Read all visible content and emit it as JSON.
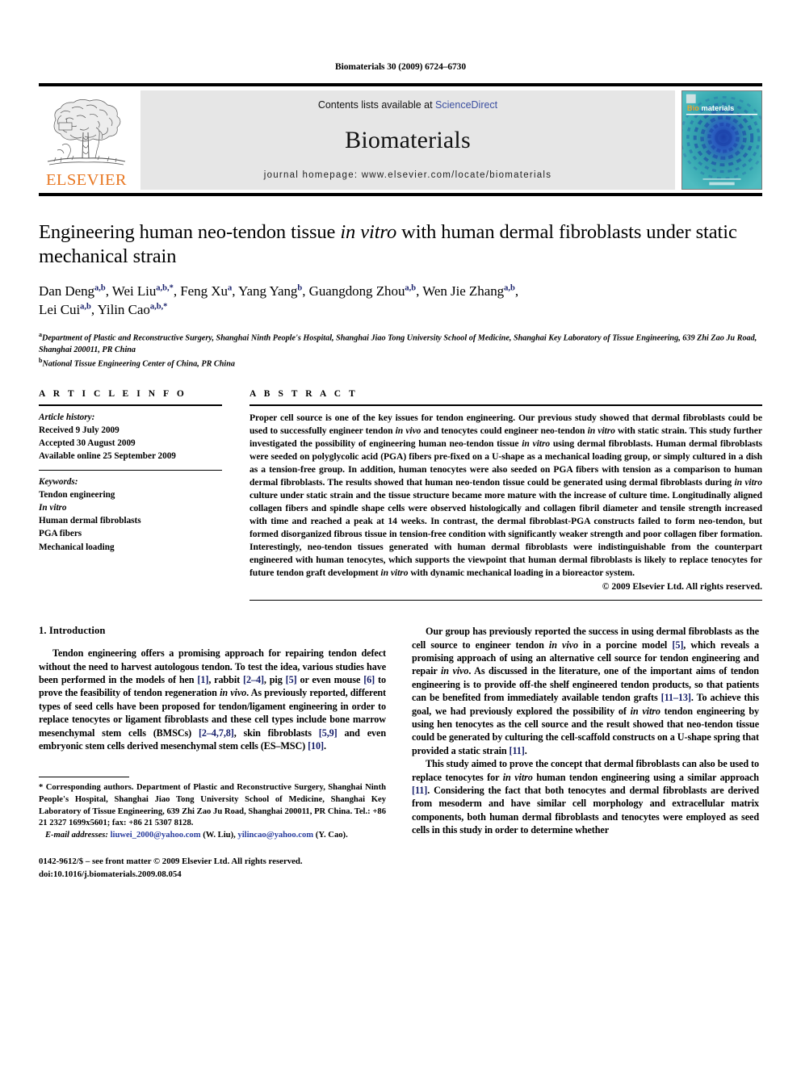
{
  "running_head": "Biomaterials 30 (2009) 6724–6730",
  "masthead": {
    "publisher_name": "ELSEVIER",
    "contents_prefix": "Contents lists available at ",
    "contents_link": "ScienceDirect",
    "journal_title": "Biomaterials",
    "homepage": "journal homepage: www.elsevier.com/locate/biomaterials",
    "cover_title_bio": "Bio",
    "cover_title_materials": "materials"
  },
  "article": {
    "title_part1": "Engineering human neo-tendon tissue ",
    "title_italic": "in vitro",
    "title_part2": " with human dermal fibroblasts under static mechanical strain",
    "authors": "Dan Deng a,b, Wei Liu a,b,*, Feng Xu a, Yang Yang b, Guangdong Zhou a,b, Wen Jie Zhang a,b, Lei Cui a,b, Yilin Cao a,b,*",
    "affiliation_a": "Department of Plastic and Reconstructive Surgery, Shanghai Ninth People's Hospital, Shanghai Jiao Tong University School of Medicine, Shanghai Key Laboratory of Tissue Engineering, 639 Zhi Zao Ju Road, Shanghai 200011, PR China",
    "affiliation_b": "National Tissue Engineering Center of China, PR China"
  },
  "article_info": {
    "heading": "A R T I C L E   I N F O",
    "history_label": "Article history:",
    "history": [
      "Received 9 July 2009",
      "Accepted 30 August 2009",
      "Available online 25 September 2009"
    ],
    "keywords_label": "Keywords:",
    "keywords": [
      "Tendon engineering",
      "In vitro",
      "Human dermal fibroblasts",
      "PGA fibers",
      "Mechanical loading"
    ]
  },
  "abstract": {
    "heading": "A B S T R A C T",
    "text": "Proper cell source is one of the key issues for tendon engineering. Our previous study showed that dermal fibroblasts could be used to successfully engineer tendon in vivo and tenocytes could engineer neo-tendon in vitro with static strain. This study further investigated the possibility of engineering human neo-tendon tissue in vitro using dermal fibroblasts. Human dermal fibroblasts were seeded on polyglycolic acid (PGA) fibers pre-fixed on a U-shape as a mechanical loading group, or simply cultured in a dish as a tension-free group. In addition, human tenocytes were also seeded on PGA fibers with tension as a comparison to human dermal fibroblasts. The results showed that human neo-tendon tissue could be generated using dermal fibroblasts during in vitro culture under static strain and the tissue structure became more mature with the increase of culture time. Longitudinally aligned collagen fibers and spindle shape cells were observed histologically and collagen fibril diameter and tensile strength increased with time and reached a peak at 14 weeks. In contrast, the dermal fibroblast-PGA constructs failed to form neo-tendon, but formed disorganized fibrous tissue in tension-free condition with significantly weaker strength and poor collagen fiber formation. Interestingly, neo-tendon tissues generated with human dermal fibroblasts were indistinguishable from the counterpart engineered with human tenocytes, which supports the viewpoint that human dermal fibroblasts is likely to replace tenocytes for future tendon graft development in vitro with dynamic mechanical loading in a bioreactor system.",
    "copyright": "© 2009 Elsevier Ltd. All rights reserved."
  },
  "introduction": {
    "heading": "1. Introduction",
    "left_paragraph": "Tendon engineering offers a promising approach for repairing tendon defect without the need to harvest autologous tendon. To test the idea, various studies have been performed in the models of hen [1], rabbit [2–4], pig [5] or even mouse [6] to prove the feasibility of tendon regeneration in vivo. As previously reported, different types of seed cells have been proposed for tendon/ligament engineering in order to replace tenocytes or ligament fibroblasts and these cell types include bone marrow mesenchymal stem cells (BMSCs) [2–4,7,8], skin fibroblasts [5,9] and even embryonic stem cells derived mesenchymal stem cells (ES–MSC) [10].",
    "right_paragraph_1": "Our group has previously reported the success in using dermal fibroblasts as the cell source to engineer tendon in vivo in a porcine model [5], which reveals a promising approach of using an alternative cell source for tendon engineering and repair in vivo. As discussed in the literature, one of the important aims of tendon engineering is to provide off-the shelf engineered tendon products, so that patients can be benefited from immediately available tendon grafts [11–13]. To achieve this goal, we had previously explored the possibility of in vitro tendon engineering by using hen tenocytes as the cell source and the result showed that neo-tendon tissue could be generated by culturing the cell-scaffold constructs on a U-shape spring that provided a static strain [11].",
    "right_paragraph_2": "This study aimed to prove the concept that dermal fibroblasts can also be used to replace tenocytes for in vitro human tendon engineering using a similar approach [11]. Considering the fact that both tenocytes and dermal fibroblasts are derived from mesoderm and have similar cell morphology and extracellular matrix components, both human dermal fibroblasts and tenocytes were employed as seed cells in this study in order to determine whether"
  },
  "footnote": {
    "corresponding": "* Corresponding authors. Department of Plastic and Reconstructive Surgery, Shanghai Ninth People's Hospital, Shanghai Jiao Tong University School of Medicine, Shanghai Key Laboratory of Tissue Engineering, 639 Zhi Zao Ju Road, Shanghai 200011, PR China. Tel.: +86 21 2327 1699x5601; fax: +86 21 5307 8128.",
    "email_label": "E-mail addresses:",
    "email_1": "liuwei_2000@yahoo.com",
    "email_1_owner": "(W. Liu),",
    "email_2": "yilincao@yahoo.com",
    "email_2_owner": "(Y. Cao).",
    "issn_line": "0142-9612/$ – see front matter © 2009 Elsevier Ltd. All rights reserved.",
    "doi_line": "doi:10.1016/j.biomaterials.2009.08.054"
  },
  "colors": {
    "link_blue": "#3b4fa0",
    "ref_navy": "#18206b",
    "elsevier_orange": "#E87722",
    "band_gray": "#e6e6e6",
    "cover_teal": "#2fa0a8"
  }
}
